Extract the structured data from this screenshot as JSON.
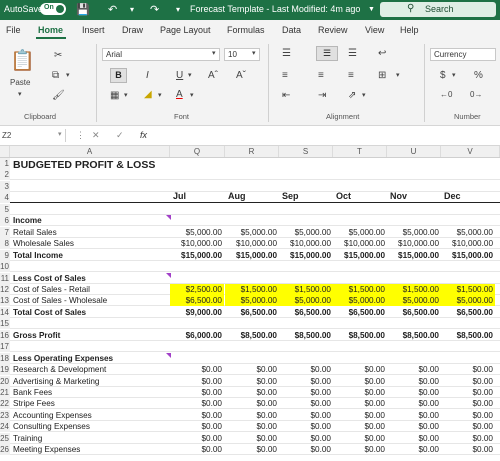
{
  "titlebar": {
    "autosave_label": "AutoSave",
    "autosave_state": "On",
    "document_title": "Forecast Template  -  Last Modified: 4m ago",
    "search_placeholder": "Search",
    "brand_color": "#1e7145"
  },
  "menu": {
    "tabs": [
      "File",
      "Home",
      "Insert",
      "Draw",
      "Page Layout",
      "Formulas",
      "Data",
      "Review",
      "View",
      "Help"
    ],
    "active": "Home"
  },
  "ribbon": {
    "clipboard_label": "Clipboard",
    "paste_label": "Paste",
    "font_label": "Font",
    "alignment_label": "Alignment",
    "number_label": "Number",
    "font_name": "Arial",
    "font_size": "10",
    "number_format": "Currency",
    "bold": "B",
    "italic": "I",
    "underline": "U"
  },
  "formula_bar": {
    "cell_ref": "Z2",
    "fx": "fx",
    "content": ""
  },
  "sheet": {
    "columns": [
      "A",
      "Q",
      "R",
      "S",
      "T",
      "U",
      "V"
    ],
    "title": "BUDGETED PROFIT & LOSS",
    "months": [
      "Jul",
      "Aug",
      "Sep",
      "Oct",
      "Nov",
      "Dec"
    ],
    "row_numbers": [
      "1",
      "2",
      "3",
      "4",
      "5",
      "6",
      "7",
      "8",
      "9",
      "10",
      "11",
      "12",
      "13",
      "14",
      "15",
      "16",
      "17",
      "18",
      "19",
      "20",
      "21",
      "22",
      "23",
      "24",
      "25",
      "26"
    ],
    "rows": [
      {
        "r": "6",
        "label": "Income",
        "bold": true,
        "values": [
          "",
          "",
          "",
          "",
          "",
          ""
        ]
      },
      {
        "r": "7",
        "label": "Retail Sales",
        "values": [
          "$5,000.00",
          "$5,000.00",
          "$5,000.00",
          "$5,000.00",
          "$5,000.00",
          "$5,000.00"
        ]
      },
      {
        "r": "8",
        "label": "Wholesale Sales",
        "values": [
          "$10,000.00",
          "$10,000.00",
          "$10,000.00",
          "$10,000.00",
          "$10,000.00",
          "$10,000.00"
        ]
      },
      {
        "r": "9",
        "label": "Total Income",
        "bold": true,
        "values": [
          "$15,000.00",
          "$15,000.00",
          "$15,000.00",
          "$15,000.00",
          "$15,000.00",
          "$15,000.00"
        ]
      },
      {
        "r": "11",
        "label": "Less Cost of Sales",
        "bold": true,
        "values": [
          "",
          "",
          "",
          "",
          "",
          ""
        ]
      },
      {
        "r": "12",
        "label": "Cost of Sales - Retail",
        "highlight": true,
        "values": [
          "$2,500.00",
          "$1,500.00",
          "$1,500.00",
          "$1,500.00",
          "$1,500.00",
          "$1,500.00"
        ]
      },
      {
        "r": "13",
        "label": "Cost of Sales - Wholesale",
        "highlight": true,
        "values": [
          "$6,500.00",
          "$5,000.00",
          "$5,000.00",
          "$5,000.00",
          "$5,000.00",
          "$5,000.00"
        ]
      },
      {
        "r": "14",
        "label": "Total Cost of Sales",
        "bold": true,
        "values": [
          "$9,000.00",
          "$6,500.00",
          "$6,500.00",
          "$6,500.00",
          "$6,500.00",
          "$6,500.00"
        ]
      },
      {
        "r": "16",
        "label": "Gross Profit",
        "bold": true,
        "values": [
          "$6,000.00",
          "$8,500.00",
          "$8,500.00",
          "$8,500.00",
          "$8,500.00",
          "$8,500.00"
        ]
      },
      {
        "r": "18",
        "label": "Less Operating Expenses",
        "bold": true,
        "values": [
          "",
          "",
          "",
          "",
          "",
          ""
        ]
      },
      {
        "r": "19",
        "label": "Research & Development",
        "values": [
          "$0.00",
          "$0.00",
          "$0.00",
          "$0.00",
          "$0.00",
          "$0.00"
        ]
      },
      {
        "r": "20",
        "label": "Advertising & Marketing",
        "values": [
          "$0.00",
          "$0.00",
          "$0.00",
          "$0.00",
          "$0.00",
          "$0.00"
        ]
      },
      {
        "r": "21",
        "label": "Bank Fees",
        "values": [
          "$0.00",
          "$0.00",
          "$0.00",
          "$0.00",
          "$0.00",
          "$0.00"
        ]
      },
      {
        "r": "22",
        "label": "Stripe Fees",
        "values": [
          "$0.00",
          "$0.00",
          "$0.00",
          "$0.00",
          "$0.00",
          "$0.00"
        ]
      },
      {
        "r": "23",
        "label": "Accounting Expenses",
        "values": [
          "$0.00",
          "$0.00",
          "$0.00",
          "$0.00",
          "$0.00",
          "$0.00"
        ]
      },
      {
        "r": "24",
        "label": "Consulting Expenses",
        "values": [
          "$0.00",
          "$0.00",
          "$0.00",
          "$0.00",
          "$0.00",
          "$0.00"
        ]
      },
      {
        "r": "25",
        "label": "Training",
        "values": [
          "$0.00",
          "$0.00",
          "$0.00",
          "$0.00",
          "$0.00",
          "$0.00"
        ]
      },
      {
        "r": "26",
        "label": "Meeting Expenses",
        "values": [
          "$0.00",
          "$0.00",
          "$0.00",
          "$0.00",
          "$0.00",
          "$0.00"
        ]
      }
    ],
    "highlight_color": "#ffff00",
    "comment_flag_color": "#a240c8"
  }
}
